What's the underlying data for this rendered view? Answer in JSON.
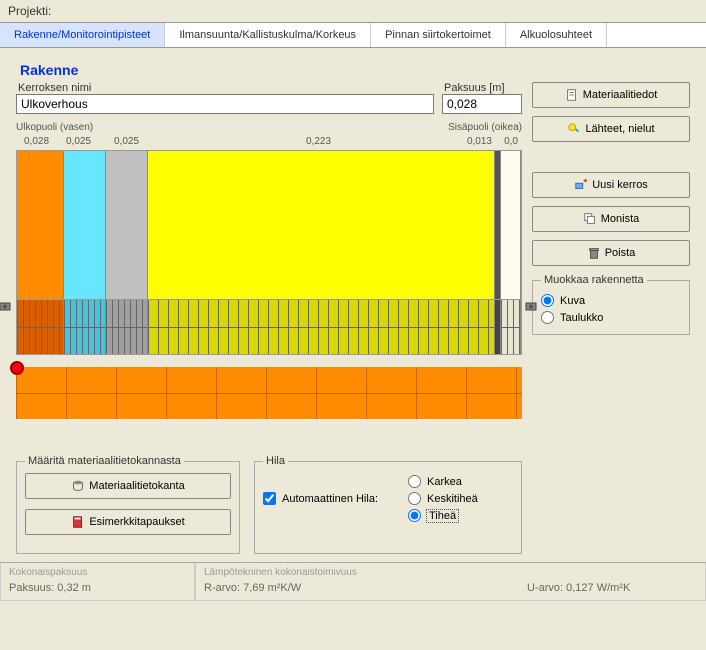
{
  "window": {
    "title": "Projekti:"
  },
  "tabs": [
    "Rakenne/Monitorointipisteet",
    "Ilmansuunta/Kallistuskulma/Korkeus",
    "Pinnan siirtokertoimet",
    "Alkuolosuhteet"
  ],
  "structure": {
    "heading": "Rakenne",
    "layer_name_label": "Kerroksen nimi",
    "layer_name_value": "Ulkoverhous",
    "thickness_label": "Paksuus [m]",
    "thickness_value": "0,028"
  },
  "dim": {
    "left_label": "Ulkopuoli (vasen)",
    "right_label": "Sisäpuoli (oikea)",
    "ticks": [
      "0,028",
      "0,025",
      "0,025",
      "0,223",
      "0,013"
    ],
    "tick_far_right": "0,0"
  },
  "buttons": {
    "material_info": "Materiaalitiedot",
    "sources_sinks": "Lähteet, nielut",
    "new_layer": "Uusi kerros",
    "duplicate": "Monista",
    "delete": "Poista",
    "material_db": "Materiaalitietokanta",
    "examples": "Esimerkkitapaukset"
  },
  "edit_structure": {
    "legend": "Muokkaa rakennetta",
    "opt_image": "Kuva",
    "opt_table": "Taulukko"
  },
  "define_panel": {
    "legend": "Määritä materiaalitietokannasta"
  },
  "grid_panel": {
    "legend": "Hila",
    "auto_label": "Automaattinen Hila:",
    "opt_coarse": "Karkea",
    "opt_medium": "Keskitiheä",
    "opt_fine": "Tiheä"
  },
  "footer": {
    "thickness_title": "Kokonaispaksuus",
    "thickness_val": "Paksuus: 0,32 m",
    "thermal_title": "Lämpötekninen kokonaistoimivuus",
    "r_value": "R-arvo: 7,69 m²K/W",
    "u_value": "U-arvo: 0,127 W/m²K"
  }
}
